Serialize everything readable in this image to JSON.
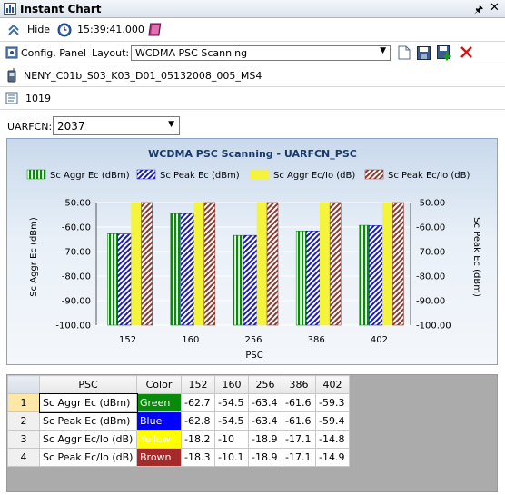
{
  "window": {
    "title": "Instant Chart",
    "pin_icon": "pin-icon",
    "close_icon": "close-icon"
  },
  "toolbar1": {
    "hide_label": "Hide",
    "time": "15:39:41.000"
  },
  "toolbar2": {
    "config_label": "Config. Panel",
    "layout_label": "Layout:",
    "layout_value": "WCDMA PSC Scanning"
  },
  "file": {
    "name": "NENY_C01b_S03_K03_D01_05132008_005_MS4"
  },
  "info": {
    "value": "1019"
  },
  "uarfcn": {
    "label": "UARFCN:",
    "value": "2037"
  },
  "colors": {
    "green": "#0a8a0a",
    "blue": "#1c1cb8",
    "yellow": "#f2f23c",
    "brown": "#8b3a30"
  },
  "chart_data": {
    "type": "bar",
    "title": "WCDMA PSC Scanning - UARFCN_PSC",
    "xlabel": "PSC",
    "ylabel": "Sc Aggr Ec (dBm)",
    "y2label": "Sc Peak Ec (dBm)",
    "ylim": [
      -100,
      -50
    ],
    "yticks": [
      "-50.00",
      "-60.00",
      "-70.00",
      "-80.00",
      "-90.00",
      "-100.00"
    ],
    "categories": [
      "152",
      "160",
      "256",
      "386",
      "402"
    ],
    "legend_position": "top",
    "series": [
      {
        "name": "Sc Aggr Ec (dBm)",
        "color": "#0a8a0a",
        "pattern": "vertical-stripes",
        "values": [
          -62.7,
          -54.5,
          -63.4,
          -61.6,
          -59.3
        ]
      },
      {
        "name": "Sc Peak Ec (dBm)",
        "color": "#1c1cb8",
        "pattern": "diagonal-hatch",
        "values": [
          -62.8,
          -54.5,
          -63.4,
          -61.6,
          -59.4
        ]
      },
      {
        "name": "Sc Aggr Ec/Io (dB)",
        "color": "#f2f23c",
        "pattern": "solid",
        "values": [
          -18.2,
          -10,
          -18.9,
          -17.1,
          -14.8
        ]
      },
      {
        "name": "Sc Peak Ec/Io (dB)",
        "color": "#8b3a30",
        "pattern": "diagonal-hatch",
        "values": [
          -18.3,
          -10.1,
          -18.9,
          -17.1,
          -14.9
        ]
      }
    ]
  },
  "table": {
    "headers": [
      "PSC",
      "Color",
      "152",
      "160",
      "256",
      "386",
      "402"
    ],
    "rows": [
      {
        "num": "1",
        "label": "Sc Aggr Ec (dBm)",
        "color_name": "Green",
        "color_hex": "#0a8a0a",
        "text_color": "#ffffff",
        "values": [
          "-62.7",
          "-54.5",
          "-63.4",
          "-61.6",
          "-59.3"
        ]
      },
      {
        "num": "2",
        "label": "Sc Peak Ec (dBm)",
        "color_name": "Blue",
        "color_hex": "#0000ff",
        "text_color": "#ffffff",
        "values": [
          "-62.8",
          "-54.5",
          "-63.4",
          "-61.6",
          "-59.4"
        ]
      },
      {
        "num": "3",
        "label": "Sc Aggr Ec/Io (dB)",
        "color_name": "Yellow",
        "color_hex": "#ffff00",
        "text_color": "#ffffff",
        "values": [
          "-18.2",
          "-10",
          "-18.9",
          "-17.1",
          "-14.8"
        ]
      },
      {
        "num": "4",
        "label": "Sc Peak Ec/Io (dB)",
        "color_name": "Brown",
        "color_hex": "#a52a2a",
        "text_color": "#ffffff",
        "values": [
          "-18.3",
          "-10.1",
          "-18.9",
          "-17.1",
          "-14.9"
        ]
      }
    ]
  }
}
